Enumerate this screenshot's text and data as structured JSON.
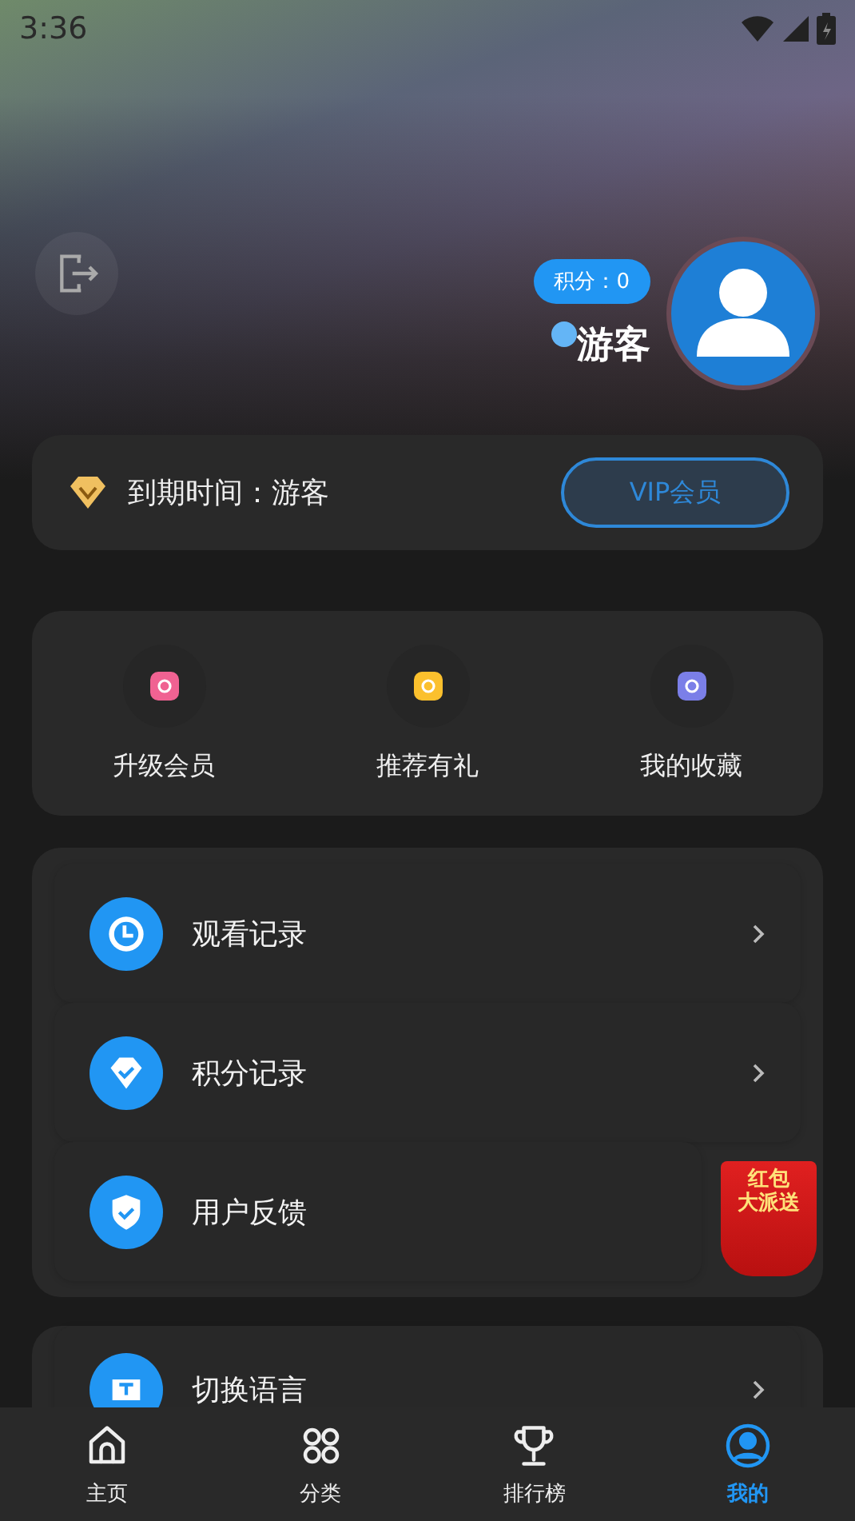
{
  "status_bar": {
    "time": "3:36"
  },
  "profile": {
    "points_badge": "积分：0",
    "username": "游客",
    "online": true
  },
  "vip_card": {
    "expiry": "到期时间：游客",
    "button": "VIP会员"
  },
  "shortcuts": [
    {
      "label": "升级会员",
      "color": "#f06292"
    },
    {
      "label": "推荐有礼",
      "color": "#fbc02d"
    },
    {
      "label": "我的收藏",
      "color": "#7b7fe8"
    }
  ],
  "menu": [
    {
      "label": "观看记录",
      "kind": "clock",
      "chevron": true
    },
    {
      "label": "积分记录",
      "kind": "tag",
      "chevron": true
    },
    {
      "label": "用户反馈",
      "kind": "shield",
      "chevron": false
    }
  ],
  "menu2": [
    {
      "label": "切换语言",
      "kind": "language",
      "chevron": true
    }
  ],
  "promo": {
    "lines": [
      "红包",
      "大派送"
    ]
  },
  "tabs": [
    {
      "label": "主页",
      "kind": "home",
      "selected": false
    },
    {
      "label": "分类",
      "kind": "grid",
      "selected": false
    },
    {
      "label": "排行榜",
      "kind": "trophy",
      "selected": false
    },
    {
      "label": "我的",
      "kind": "user",
      "selected": true
    }
  ]
}
